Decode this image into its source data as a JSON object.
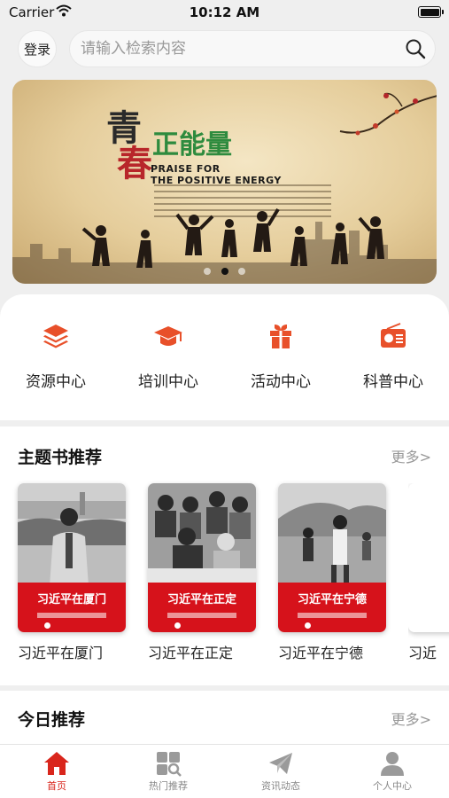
{
  "status_bar": {
    "carrier": "Carrier",
    "time": "10:12 AM"
  },
  "header": {
    "login_label": "登录",
    "search_placeholder": "请输入检索内容"
  },
  "banner": {
    "title_chars": [
      "青",
      "春"
    ],
    "headline": "正能量",
    "english_line1": "PRAISE FOR",
    "english_line2": "THE POSITIVE ENERGY",
    "page_count": 3,
    "active_page": 2
  },
  "quick_nav": [
    {
      "label": "资源中心",
      "icon": "layers-icon"
    },
    {
      "label": "培训中心",
      "icon": "graduation-cap-icon"
    },
    {
      "label": "活动中心",
      "icon": "gift-icon"
    },
    {
      "label": "科普中心",
      "icon": "radio-icon"
    }
  ],
  "theme_books": {
    "title": "主题书推荐",
    "more": "更多>",
    "books": [
      {
        "cover_title": "习近平在厦门",
        "title": "习近平在厦门"
      },
      {
        "cover_title": "习近平在正定",
        "title": "习近平在正定"
      },
      {
        "cover_title": "习近平在宁德",
        "title": "习近平在宁德"
      },
      {
        "cover_title": "",
        "title": "习近"
      }
    ]
  },
  "today": {
    "title": "今日推荐",
    "more": "更多>"
  },
  "tab_bar": [
    {
      "label": "首页",
      "icon": "home-icon",
      "active": true
    },
    {
      "label": "热门推荐",
      "icon": "hot-recommend-icon",
      "active": false
    },
    {
      "label": "资讯动态",
      "icon": "paper-plane-icon",
      "active": false
    },
    {
      "label": "个人中心",
      "icon": "user-icon",
      "active": false
    }
  ],
  "colors": {
    "accent": "#d9261c",
    "icon_orange": "#e8502a",
    "book_red": "#d6121b"
  }
}
